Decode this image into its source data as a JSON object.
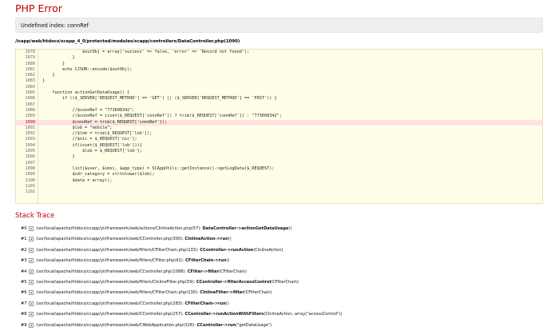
{
  "error": {
    "title": "PHP Error",
    "message": "Undefined index: connRef",
    "file": "/icapp/web/htdocs/scapp_4_0/protected/modules/scapp/controllers/DataController.php(1090)"
  },
  "source": {
    "error_line": 1090,
    "lines": [
      {
        "num": "1078",
        "code": "                $outObj = array('success' => false, 'error' => 'Record not found');"
      },
      {
        "num": "1079",
        "code": "            }"
      },
      {
        "num": "1080",
        "code": "        }"
      },
      {
        "num": "1081",
        "code": "        echo CJSON::encode($outObj);"
      },
      {
        "num": "1082",
        "code": "    }"
      },
      {
        "num": "1083",
        "code": "}"
      },
      {
        "num": "1084",
        "code": ""
      },
      {
        "num": "1085",
        "code": "    function actionGetDataUsage() {"
      },
      {
        "num": "1086",
        "code": "        if (($_SERVER['REQUEST_METHOD'] == 'GET') || ($_SERVER['REQUEST_METHOD'] == 'POST')) {"
      },
      {
        "num": "1087",
        "code": ""
      },
      {
        "num": "1088",
        "code": "            //$connRef = \"773608342\";"
      },
      {
        "num": "1089",
        "code": "            //$connRef = isset($_REQUEST['connRef']) ? trim($_REQUEST['connRef']) : \"773608342\";"
      },
      {
        "num": "1090",
        "code": "            $connRef = trim($_REQUEST['connRef']);"
      },
      {
        "num": "1091",
        "code": "            $lob = \"mobile\";"
      },
      {
        "num": "1092",
        "code": "            //$lob = trim($_REQUEST['lob']);"
      },
      {
        "num": "1093",
        "code": "            //$nic = $_REQUEST['nic'];"
      },
      {
        "num": "1094",
        "code": "            if(isset($_REQUEST['lob'])){"
      },
      {
        "num": "1095",
        "code": "                $lob = $_REQUEST['lob'];"
      },
      {
        "num": "1096",
        "code": "            }"
      },
      {
        "num": "1097",
        "code": ""
      },
      {
        "num": "1098",
        "code": "            list($user, $imsi, $app_type) = SCAppUtils::getInstance()->getLogData($_REQUEST);"
      },
      {
        "num": "1099",
        "code": "            $cdr_category = strtolower($lob);"
      },
      {
        "num": "1100",
        "code": "            $data = array();"
      },
      {
        "num": "1101",
        "code": ""
      },
      {
        "num": "1102",
        "code": ""
      }
    ]
  },
  "stack_trace": {
    "title": "Stack Trace",
    "items": [
      {
        "num": "#0",
        "path": "/usr/local/apache/htdocs/ccapp/yii/framework/web/actions/CInlineAction.php(57): ",
        "call": "DataController->actionGetDataUsage",
        "args": "()"
      },
      {
        "num": "#1",
        "path": "/usr/local/apache/htdocs/ccapp/yii/framework/web/CController.php(300): ",
        "call": "CInlineAction->run",
        "args": "()"
      },
      {
        "num": "#2",
        "path": "/usr/local/apache/htdocs/ccapp/yii/framework/web/filters/CFilterChain.php(133): ",
        "call": "CController->runAction",
        "args": "(CInlineAction)"
      },
      {
        "num": "#3",
        "path": "/usr/local/apache/htdocs/ccapp/yii/framework/web/filters/CFilter.php(41): ",
        "call": "CFilterChain->run",
        "args": "()"
      },
      {
        "num": "#4",
        "path": "/usr/local/apache/htdocs/ccapp/yii/framework/web/CController.php(1088): ",
        "call": "CFilter->filter",
        "args": "(CFilterChain)"
      },
      {
        "num": "#5",
        "path": "/usr/local/apache/htdocs/ccapp/yii/framework/web/filters/CInlineFilter.php(59): ",
        "call": "CController->filterAccessControl",
        "args": "(CFilterChain)"
      },
      {
        "num": "#6",
        "path": "/usr/local/apache/htdocs/ccapp/yii/framework/web/filters/CFilterChain.php(130): ",
        "call": "CInlineFilter->filter",
        "args": "(CFilterChain)"
      },
      {
        "num": "#7",
        "path": "/usr/local/apache/htdocs/ccapp/yii/framework/web/CController.php(283): ",
        "call": "CFilterChain->run",
        "args": "()"
      },
      {
        "num": "#8",
        "path": "/usr/local/apache/htdocs/ccapp/yii/framework/web/CController.php(257): ",
        "call": "CController->runActionWithFilters",
        "args": "(CInlineAction, array(\"accessControl\"))"
      },
      {
        "num": "#9",
        "path": "/usr/local/apache/htdocs/ccapp/yii/framework/web/CWebApplication.php(328): ",
        "call": "CController->run",
        "args": "(\"getDataUsage\")"
      }
    ]
  },
  "colors": {
    "title_red": "#c00000",
    "message_bg": "#eeeeee",
    "code_bg": "#ffffe8",
    "error_line_bg": "#ffe2e2"
  },
  "icons": {
    "trace_toggle": "expand-toggle-icon"
  }
}
